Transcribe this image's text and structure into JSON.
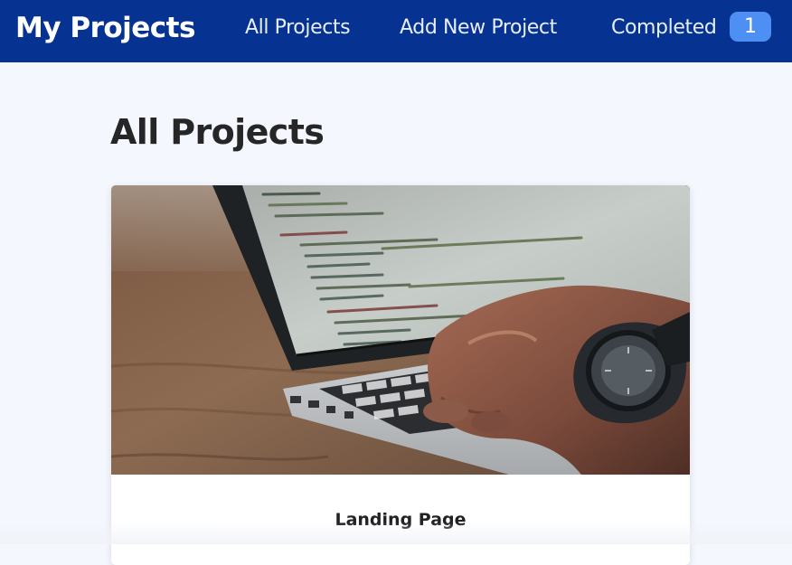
{
  "navbar": {
    "brand": "My Projects",
    "links": [
      {
        "label": "All Projects"
      },
      {
        "label": "Add New Project"
      },
      {
        "label": "Completed"
      }
    ],
    "completed_count": "1",
    "colors": {
      "background": "#063291",
      "badge": "#4d8ff2"
    }
  },
  "main": {
    "title": "All Projects",
    "projects": [
      {
        "title": "Landing Page",
        "image": "laptop-coding-photo"
      }
    ]
  },
  "colors": {
    "page_background": "#f4f7fe",
    "card_background": "#ffffff"
  }
}
